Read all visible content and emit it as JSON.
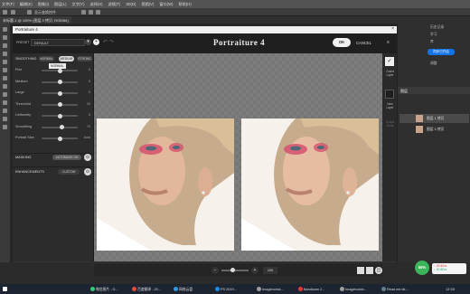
{
  "ps": {
    "menu": [
      "文件(F)",
      "编辑(E)",
      "图像(I)",
      "图层(L)",
      "文字(Y)",
      "选择(S)",
      "滤镜(T)",
      "3D(D)",
      "视图(V)",
      "窗口(W)",
      "帮助(H)"
    ],
    "options": {
      "mode_label": "显示变换控件",
      "zoom": "100%"
    },
    "doc_tab": "未标题-1 @ 100% (图层 0 拷贝, RGB/8#)",
    "right": {
      "item1": "历史记录",
      "item2": "学习",
      "item3": "库",
      "item4": "调整",
      "sync_button": "同步已开启",
      "panel_title": "图层",
      "layers": [
        "图层 1 拷贝",
        "图层 0 拷贝",
        "图层 0"
      ]
    }
  },
  "portraiture": {
    "window_title": "Portraiture 4",
    "logo": "Portraiture 4",
    "preset_label": "PRESET",
    "preset_value": "DEFAULT",
    "ok": "OK",
    "cancel": "CANCEL",
    "smoothing": {
      "title": "SMOOTHING",
      "modes": [
        "NORMAL",
        "MEDIUM",
        "STRONG"
      ],
      "active_mode": "MEDIUM",
      "tooltip": "NORMAL",
      "sliders": [
        {
          "label": "Fine",
          "value": "0"
        },
        {
          "label": "Medium",
          "value": "0"
        },
        {
          "label": "Large",
          "value": "0"
        },
        {
          "label": "Threshold",
          "value": "20"
        },
        {
          "label": "Uniformity",
          "value": "0"
        },
        {
          "label": "Smoothing",
          "value": "70"
        },
        {
          "label": "Portrait Size",
          "value": "Auto"
        }
      ],
      "slider_levels": [
        0.5,
        0.5,
        0.5,
        0.5,
        0.5,
        0.55,
        0.5
      ]
    },
    "masking": {
      "title": "MASKING",
      "value": "AUTOMASK ON"
    },
    "enhancements": {
      "title": "ENHANCEMENTS",
      "value": "CUSTOM"
    },
    "right_strip": {
      "a": "Guest Layer",
      "b": "New Layer",
      "c": "Output Mode"
    },
    "zoom": "100"
  },
  "taskbar": [
    {
      "label": "微信图片 - G..."
    },
    {
      "label": "百度翻译 - 20..."
    },
    {
      "label": "网络云盘"
    },
    {
      "label": "PS 2019..."
    },
    {
      "label": "Imagenomic..."
    },
    {
      "label": "Bandicam 2..."
    },
    {
      "label": "Imagenomic..."
    },
    {
      "label": "Read me.txt..."
    }
  ],
  "badge": "55%",
  "net": {
    "up": "↑ 29.6K/s",
    "down": "↓ 40.8K/s"
  },
  "clock": "12:33"
}
